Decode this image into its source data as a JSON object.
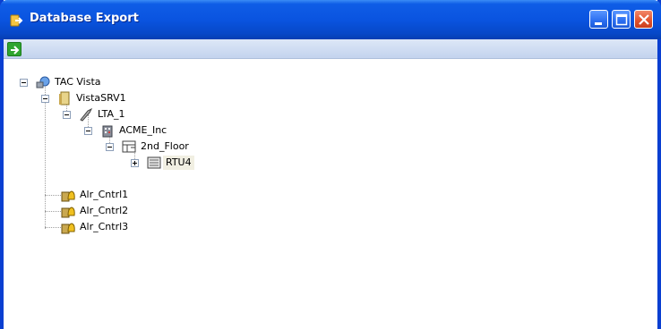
{
  "window": {
    "title": "Database Export",
    "title_icon": "export-arrow-icon"
  },
  "caption_buttons": {
    "minimize": "minimize-icon",
    "maximize": "maximize-icon",
    "close": "close-icon"
  },
  "toolbar": {
    "export_icon": "green-arrow-right-icon"
  },
  "tree": {
    "root": {
      "label": "TAC Vista",
      "icon": "network-globe-icon",
      "expanded": true
    },
    "server": {
      "label": "VistaSRV1",
      "icon": "server-icon",
      "expanded": true
    },
    "lta": {
      "label": "LTA_1",
      "icon": "key-icon",
      "expanded": true
    },
    "company": {
      "label": "ACME_Inc",
      "icon": "building-icon",
      "expanded": true
    },
    "floor": {
      "label": "2nd_Floor",
      "icon": "floor-icon",
      "expanded": true
    },
    "rtu": {
      "label": "RTU4",
      "icon": "controller-icon",
      "expanded": false,
      "selected": true
    },
    "alarms": [
      {
        "label": "Alr_Cntrl1",
        "icon": "alarm-bell-icon"
      },
      {
        "label": "Alr_Cntrl2",
        "icon": "alarm-bell-icon"
      },
      {
        "label": "Alr_Cntrl3",
        "icon": "alarm-bell-icon"
      }
    ]
  },
  "colors": {
    "title_bar": "#0a54e0",
    "toolbar": "#c3d3ee",
    "close_button": "#e0502a",
    "selection": "#f1efe2"
  }
}
